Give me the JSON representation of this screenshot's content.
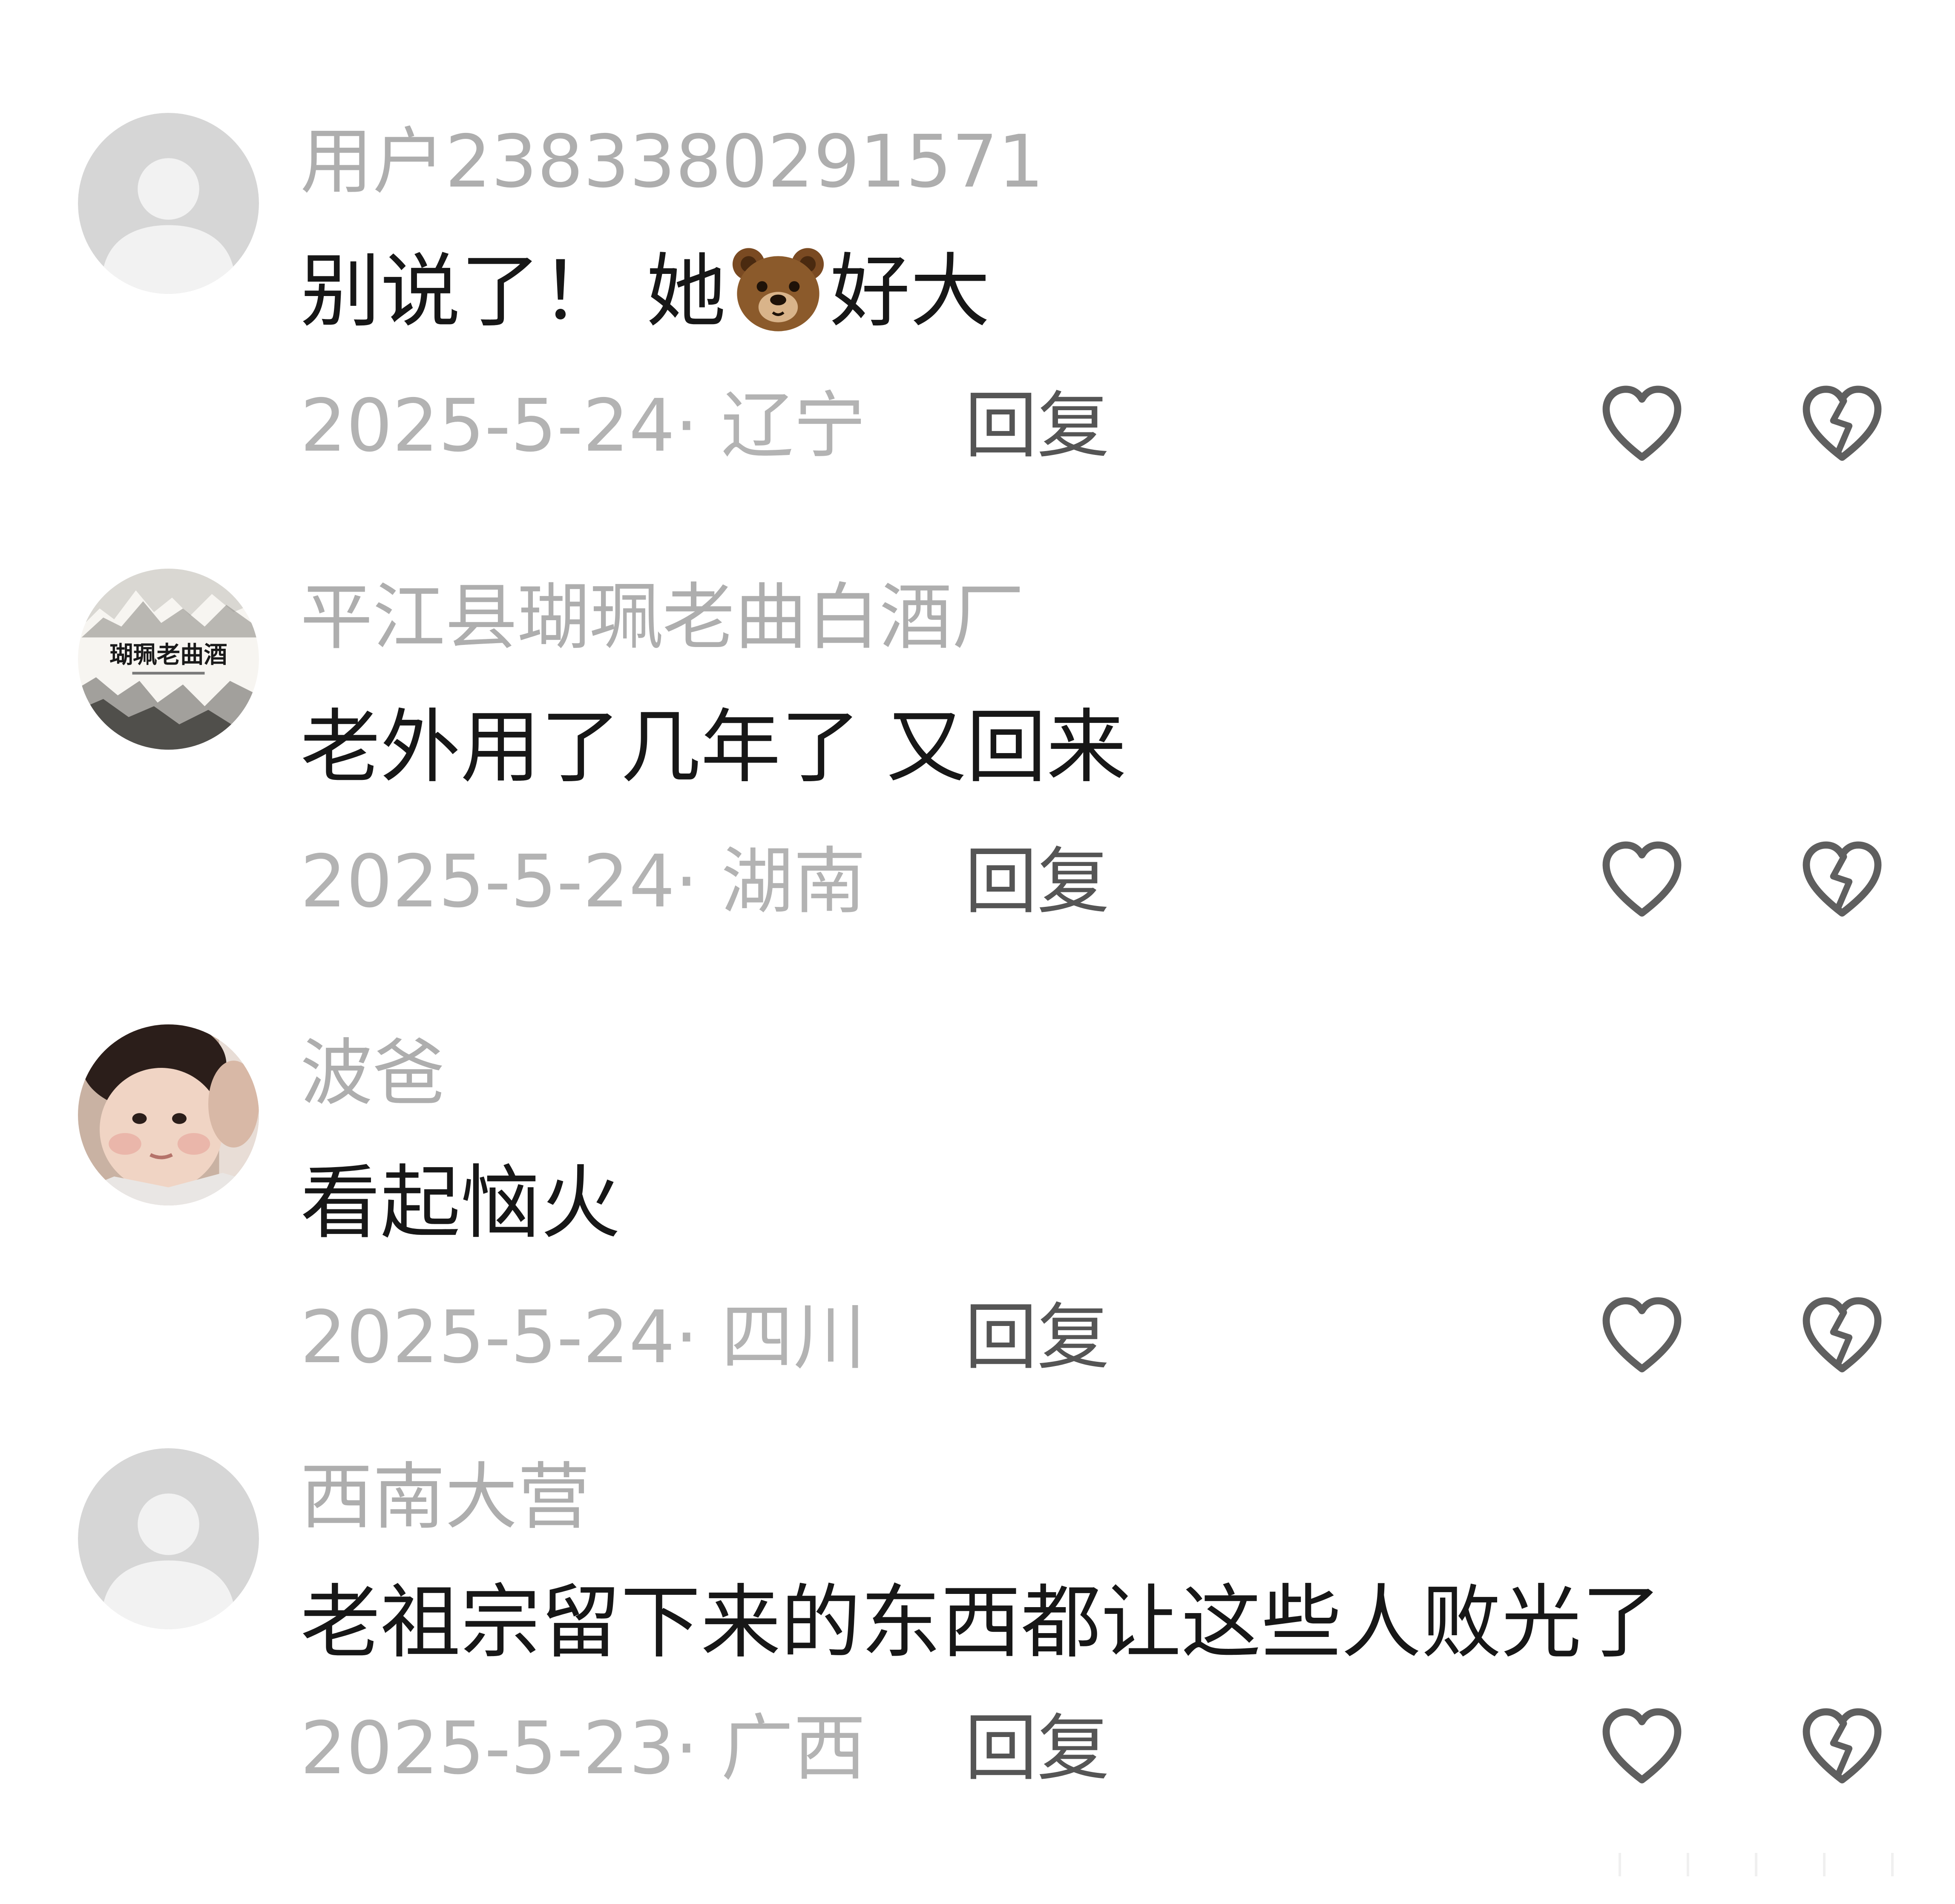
{
  "colors": {
    "username": "#aeaeae",
    "text": "#171717",
    "meta": "#b3b3b3",
    "reply": "#555555",
    "icon": "#5f5f5f",
    "default_avatar_bg": "#d6d6d6"
  },
  "comments": [
    {
      "username": "用户2383380291571",
      "text_before": "别说了！ 她",
      "emoji": "bear-face",
      "text_after": "好大",
      "date_location": "2025-5-24· 辽宁",
      "reply_label": "回复",
      "avatar": "default-avatar"
    },
    {
      "username": "平江县瑚珮老曲白酒厂",
      "text": "老外用了几年了 又回来",
      "date_location": "2025-5-24· 湖南",
      "reply_label": "回复",
      "avatar": "ink-landscape-logo",
      "avatar_text": "瑚珮老曲酒"
    },
    {
      "username": "波爸",
      "text": "看起恼火",
      "date_location": "2025-5-24· 四川",
      "reply_label": "回复",
      "avatar": "baby-photo"
    },
    {
      "username": "西南大营",
      "text": "老祖宗留下来的东西都让这些人败光了",
      "date_location": "2025-5-23· 广西",
      "reply_label": "回复",
      "avatar": "default-avatar"
    }
  ]
}
